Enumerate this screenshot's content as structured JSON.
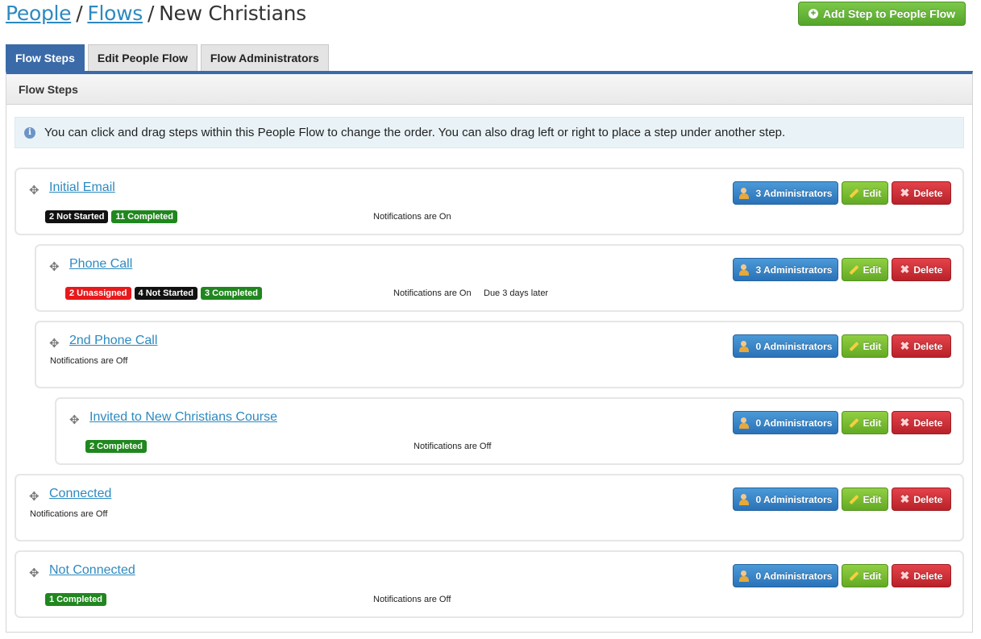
{
  "breadcrumb": {
    "people": "People",
    "sep1": "/",
    "flows": "Flows",
    "sep2": "/",
    "current": "New Christians"
  },
  "add_step_label": "Add Step to People Flow",
  "tabs": [
    {
      "label": "Flow Steps",
      "active": true
    },
    {
      "label": "Edit People Flow",
      "active": false
    },
    {
      "label": "Flow Administrators",
      "active": false
    }
  ],
  "panel_title": "Flow Steps",
  "info_text": "You can click and drag steps within this People Flow to change the order. You can also drag left or right to place a step under another step.",
  "buttons": {
    "edit": "Edit",
    "delete": "Delete"
  },
  "steps": [
    {
      "title": "Initial Email",
      "admins": "3 Administrators",
      "badges": [
        {
          "text": "2 Not Started",
          "color": "#111111"
        },
        {
          "text": "11 Completed",
          "color": "#20871e"
        }
      ],
      "notifications": "Notifications are On",
      "due": ""
    },
    {
      "title": "Phone Call",
      "admins": "3 Administrators",
      "badges": [
        {
          "text": "2 Unassigned",
          "color": "#e8191b"
        },
        {
          "text": "4 Not Started",
          "color": "#111111"
        },
        {
          "text": "3 Completed",
          "color": "#20871e"
        }
      ],
      "notifications": "Notifications are On",
      "due": "Due 3 days later"
    },
    {
      "title": "2nd Phone Call",
      "admins": "0 Administrators",
      "badges": [],
      "notifications": "Notifications are Off",
      "due": ""
    },
    {
      "title": "Invited to New Christians Course",
      "admins": "0 Administrators",
      "badges": [
        {
          "text": "2 Completed",
          "color": "#20871e"
        }
      ],
      "notifications": "Notifications are Off",
      "due": ""
    },
    {
      "title": "Connected",
      "admins": "0 Administrators",
      "badges": [],
      "notifications": "Notifications are Off",
      "due": ""
    },
    {
      "title": "Not Connected",
      "admins": "0 Administrators",
      "badges": [
        {
          "text": "1 Completed",
          "color": "#20871e"
        }
      ],
      "notifications": "Notifications are Off",
      "due": ""
    }
  ]
}
